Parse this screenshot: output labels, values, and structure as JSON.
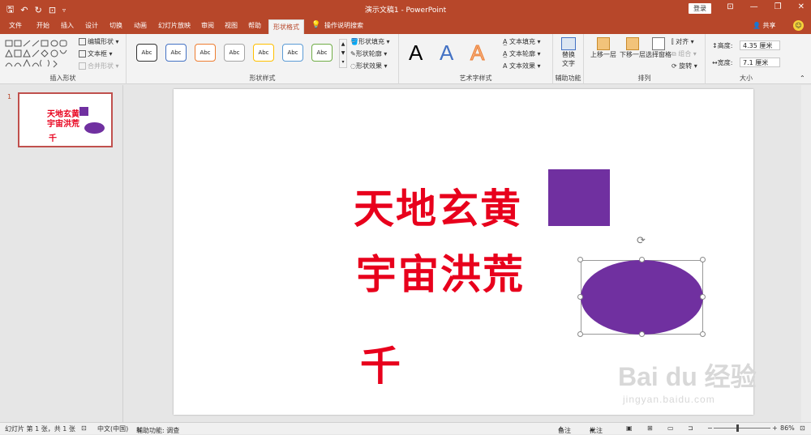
{
  "window": {
    "title": "演示文稿1 - PowerPoint",
    "login": "登录"
  },
  "tabs": [
    "文件",
    "开始",
    "插入",
    "设计",
    "切换",
    "动画",
    "幻灯片放映",
    "审阅",
    "视图",
    "帮助",
    "形状格式"
  ],
  "tell_me": "操作说明搜索",
  "share": "共享",
  "ribbon": {
    "insert_shapes": {
      "label": "插入形状",
      "edit_shape": "编辑形状",
      "text_box": "文本框",
      "merge_shapes": "合并形状"
    },
    "shape_styles": {
      "label": "形状样式",
      "sample": "Abc",
      "fill": "形状填充",
      "outline": "形状轮廓",
      "effects": "形状效果"
    },
    "wordart": {
      "label": "艺术字样式",
      "letter": "A",
      "text_fill": "文本填充",
      "text_outline": "文本轮廓",
      "text_effects": "文本效果"
    },
    "accessibility": {
      "label": "辅助功能",
      "alt_text_1": "替换",
      "alt_text_2": "文字"
    },
    "arrange": {
      "label": "排列",
      "bring_forward": "上移一层",
      "send_backward": "下移一层",
      "selection_pane": "选择窗格",
      "align": "对齐",
      "group": "组合",
      "rotate": "旋转"
    },
    "size": {
      "label": "大小",
      "height_label": "高度:",
      "height_value": "4.35 厘米",
      "width_label": "宽度:",
      "width_value": "7.1 厘米"
    }
  },
  "slide_panel": {
    "number": "1"
  },
  "slide": {
    "line1": "天地玄黄",
    "line2": "宇宙洪荒",
    "line3": "千",
    "square_color": "#7030a0",
    "ellipse_color": "#7030a0",
    "text_color": "#e8001c"
  },
  "watermark": {
    "brand": "Bai du 经验",
    "url": "jingyan.baidu.com"
  },
  "status": {
    "slide_info": "幻灯片 第 1 张，共 1 张",
    "language": "中文(中国)",
    "accessibility": "辅助功能: 调查",
    "notes": "备注",
    "comments": "批注",
    "zoom": "86%"
  }
}
